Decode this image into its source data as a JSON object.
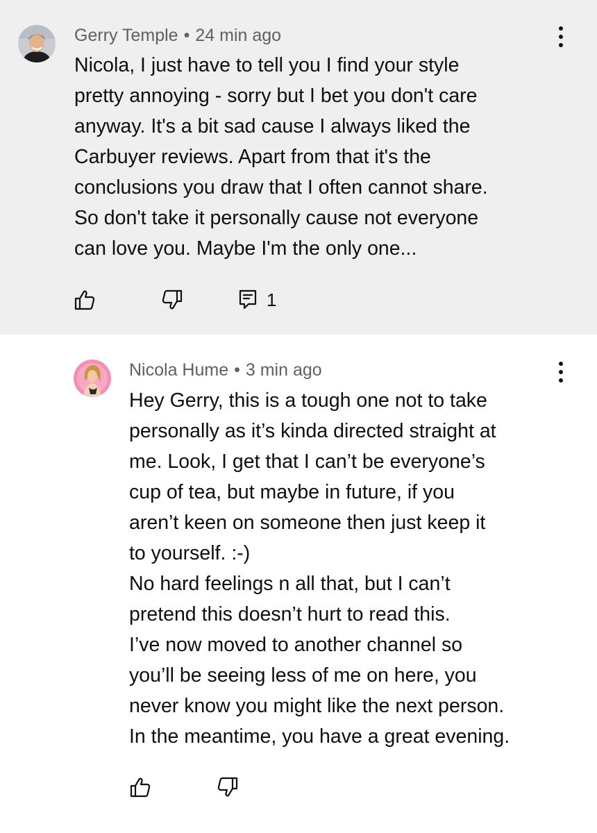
{
  "comments": [
    {
      "author": "Gerry Temple",
      "time": "24 min ago",
      "separator": "•",
      "lines": [
        "Nicola, I just have to tell you I find your style",
        "pretty annoying - sorry but I bet you don't care",
        "anyway. It's a bit sad cause I always liked the",
        "Carbuyer reviews. Apart from that it's the",
        "conclusions you draw that I often cannot share.",
        "So don't take it personally cause not everyone",
        "can love you. Maybe I'm the only one..."
      ],
      "reply_count": "1",
      "icons": {
        "like": "thumbs-up-icon",
        "dislike": "thumbs-down-icon",
        "reply": "comment-icon",
        "menu": "more-vertical-icon"
      }
    },
    {
      "author": "Nicola Hume",
      "time": "3 min ago",
      "separator": "•",
      "lines": [
        "Hey Gerry, this is a tough one not to take",
        "personally as it’s kinda directed straight at",
        "me. Look, I get that I can’t be everyone’s",
        "cup of tea, but maybe in future, if you",
        "aren’t keen on someone then just keep it",
        "to yourself. :-)",
        "No hard feelings n all that, but I can’t",
        "pretend this doesn’t hurt to read this.",
        "I’ve now moved to another channel so",
        "you’ll be seeing less of me on here, you",
        "never know you might like the next person.",
        "In the meantime, you have a great evening."
      ],
      "icons": {
        "like": "thumbs-up-icon",
        "dislike": "thumbs-down-icon",
        "menu": "more-vertical-icon"
      }
    }
  ],
  "colors": {
    "parent_bg": "#efefef",
    "reply_bg": "#ffffff",
    "meta_text": "#606060",
    "body_text": "#0f0f0f",
    "reply_avatar_bg": "#f48fb1"
  }
}
